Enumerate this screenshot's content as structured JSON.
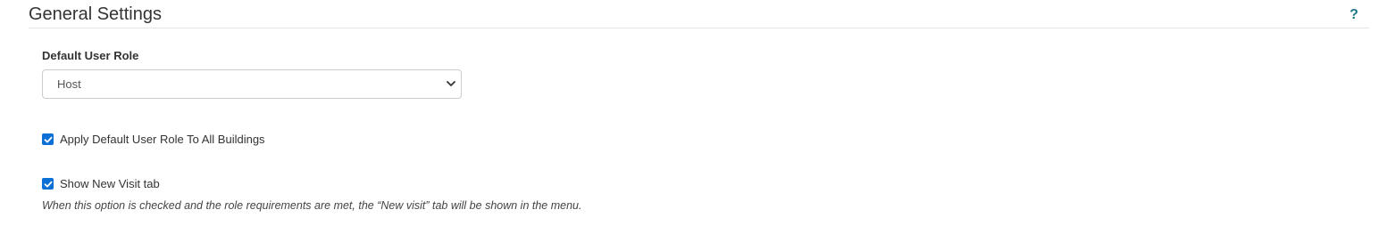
{
  "section": {
    "title": "General Settings",
    "help_label": "?"
  },
  "default_user_role": {
    "label": "Default User Role",
    "selected": "Host"
  },
  "options": {
    "apply_all_buildings": {
      "label": "Apply Default User Role To All Buildings",
      "checked": true
    },
    "show_new_visit_tab": {
      "label": "Show New Visit tab",
      "checked": true
    },
    "show_new_visit_help": "When this option is checked and the role requirements are met, the “New visit” tab will be shown in the menu."
  },
  "colors": {
    "accent": "#1f7a84",
    "checkbox": "#0b6fd6"
  }
}
